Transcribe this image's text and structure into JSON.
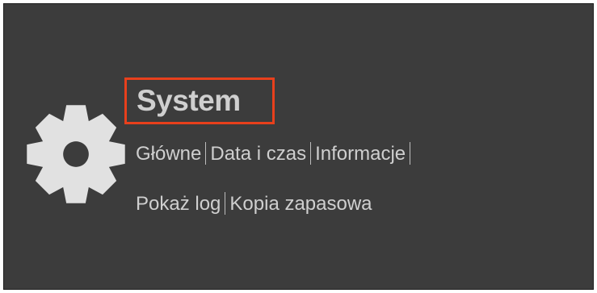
{
  "section": {
    "title": "System",
    "icon": "gear-icon",
    "highlight_color": "#e8401c"
  },
  "links": {
    "row1": [
      {
        "label": "Główne"
      },
      {
        "label": "Data i czas"
      },
      {
        "label": "Informacje"
      }
    ],
    "row2": [
      {
        "label": "Pokaż log"
      },
      {
        "label": "Kopia zapasowa"
      }
    ]
  }
}
